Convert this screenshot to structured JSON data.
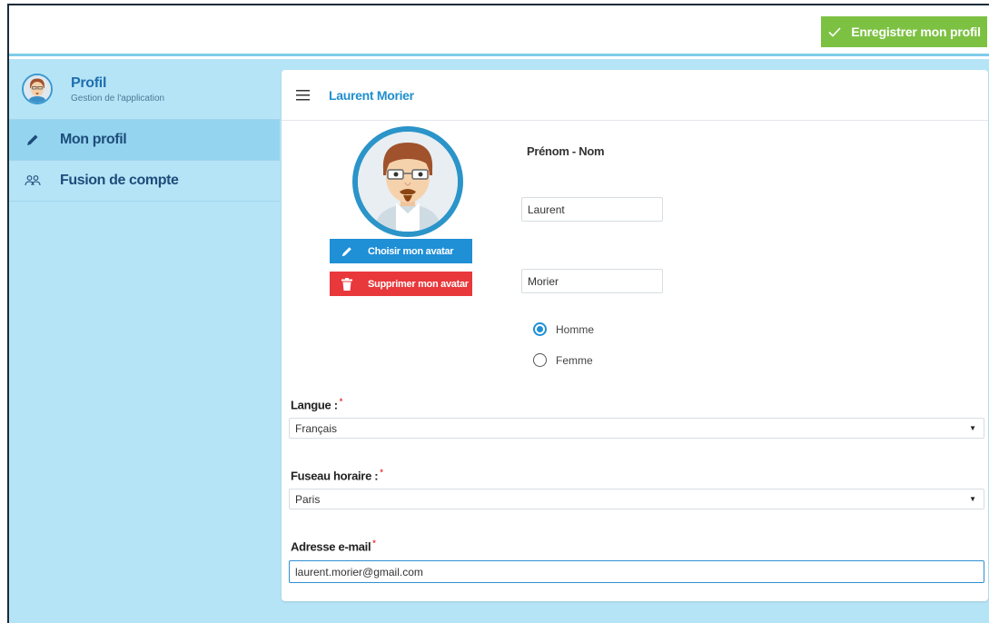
{
  "topbar": {
    "save_label": "Enregistrer mon profil",
    "save_color": "#7dc143"
  },
  "sidebar": {
    "header": {
      "title": "Profil",
      "subtitle": "Gestion de l'application"
    },
    "items": [
      {
        "label": "Mon profil",
        "icon": "pencil-icon",
        "active": true
      },
      {
        "label": "Fusion de compte",
        "icon": "users-icon",
        "active": false
      }
    ],
    "background": "#b6e4f7"
  },
  "card": {
    "header_name": "Laurent Morier",
    "avatar_buttons": {
      "choose_label": "Choisir mon avatar",
      "delete_label": "Supprimer mon avatar"
    },
    "name_section_label": "Prénom - Nom",
    "first_name_value": "Laurent",
    "last_name_value": "Morier",
    "gender_options": [
      {
        "label": "Homme",
        "checked": true
      },
      {
        "label": "Femme",
        "checked": false
      }
    ],
    "language": {
      "label": "Langue :",
      "required_mark": "*",
      "value": "Français"
    },
    "timezone": {
      "label": "Fuseau horaire :",
      "required_mark": "*",
      "value": "Paris"
    },
    "email": {
      "label": "Adresse e-mail",
      "required_mark": "*",
      "value": "laurent.morier@gmail.com"
    }
  },
  "colors": {
    "accent_blue": "#1f8fd6",
    "danger_red": "#e8383b",
    "title_blue": "#1e6fb0"
  }
}
